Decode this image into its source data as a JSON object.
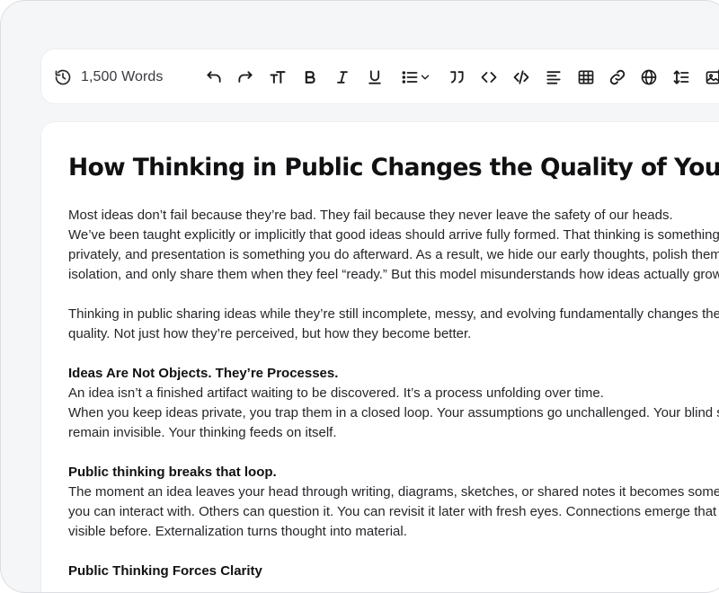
{
  "toolbar": {
    "word_count": "1,500 Words",
    "buttons": [
      {
        "name": "undo-icon"
      },
      {
        "name": "redo-icon"
      },
      {
        "name": "text-size-icon"
      },
      {
        "name": "bold-icon"
      },
      {
        "name": "italic-icon"
      },
      {
        "name": "underline-icon"
      },
      {
        "name": "bullet-list-icon"
      },
      {
        "name": "blockquote-icon"
      },
      {
        "name": "inline-code-icon"
      },
      {
        "name": "code-block-icon"
      },
      {
        "name": "align-left-icon"
      },
      {
        "name": "table-icon"
      },
      {
        "name": "link-icon"
      },
      {
        "name": "globe-icon"
      },
      {
        "name": "line-height-icon"
      },
      {
        "name": "image-icon"
      }
    ]
  },
  "document": {
    "title": "How Thinking in Public Changes the Quality of Your Ideas",
    "p1": [
      "Most ideas don’t fail because they’re bad. They fail because they never leave the safety of our heads.",
      "We’ve been taught explicitly or implicitly that good ideas should arrive fully formed. That thinking is something",
      "privately, and presentation is something you do afterward. As a result, we hide our early thoughts, polish them",
      "isolation, and only share them when they feel “ready.” But this model misunderstands how ideas actually grow."
    ],
    "p2": [
      "Thinking in public sharing ideas while they’re still incomplete, messy, and evolving fundamentally changes the",
      "quality. Not just how they’re perceived, but how they become better."
    ],
    "h2": "Ideas Are Not Objects. They’re Processes.",
    "p3": [
      "An idea isn’t a finished artifact waiting to be discovered. It’s a process unfolding over time.",
      "When you keep ideas private, you trap them in a closed loop. Your assumptions go unchallenged. Your blind s",
      "remain invisible. Your thinking feeds on itself."
    ],
    "h3": "Public thinking breaks that loop.",
    "p4": [
      "The moment an idea leaves your head through writing, diagrams, sketches, or shared notes it becomes some",
      "you can interact with. Others can question it. You can revisit it later with fresh eyes. Connections emerge that",
      "visible before. Externalization turns thought into material."
    ],
    "h4": "Public Thinking Forces Clarity"
  }
}
